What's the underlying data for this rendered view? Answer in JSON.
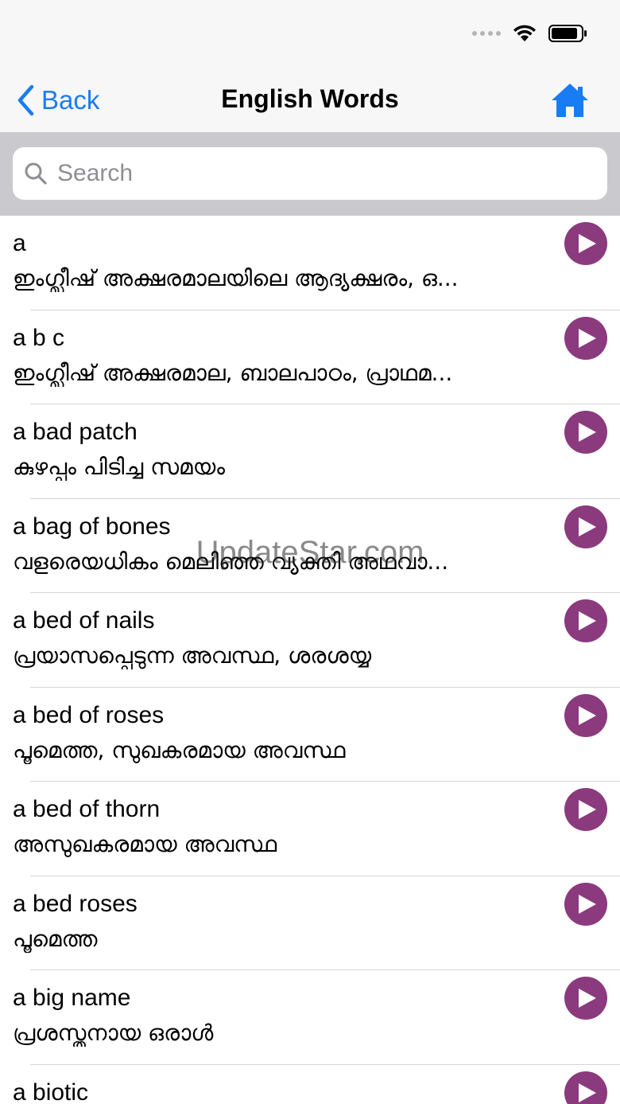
{
  "nav": {
    "back_label": "Back",
    "title": "English Words"
  },
  "search": {
    "placeholder": "Search",
    "value": ""
  },
  "colors": {
    "accent": "#1a7cf5",
    "play": "#8b3a7e"
  },
  "watermark": "UpdateStar.com",
  "words": [
    {
      "en": "a",
      "ml": "ഇംഗ്ലീഷ് അക്ഷരമാലയിലെ ആദ്യക്ഷരം, ഒ..."
    },
    {
      "en": "a b c",
      "ml": "ഇംഗ്ലീഷ് അക്ഷരമാല, ബാലപാഠം, പ്രാഥമ..."
    },
    {
      "en": "a bad patch",
      "ml": "കുഴപ്പം പിടിച്ച സമയം"
    },
    {
      "en": "a bag of bones",
      "ml": "വളരെയധികം മെലിഞ്ഞ വ്യക്തി അഥവാ..."
    },
    {
      "en": "a bed of nails",
      "ml": "പ്രയാസപ്പെടുന്ന അവസ്ഥ, ശരശയ്യ"
    },
    {
      "en": "a bed of roses",
      "ml": "പൂമെത്ത, സുഖകരമായ അവസ്ഥ"
    },
    {
      "en": "a bed of thorn",
      "ml": "അസുഖകരമായ അവസ്ഥ"
    },
    {
      "en": "a bed roses",
      "ml": "പൂമെത്ത"
    },
    {
      "en": "a big name",
      "ml": "പ്രശസ്തനായ ഒരാൾ"
    },
    {
      "en": "a biotic",
      "ml": ""
    }
  ]
}
